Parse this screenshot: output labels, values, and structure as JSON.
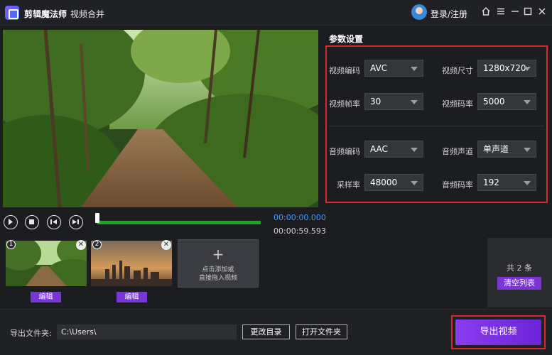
{
  "header": {
    "app_name": "剪辑魔法师",
    "separator": "-",
    "page_title": "视频合并",
    "login_label": "登录/注册",
    "icons": [
      "home-icon",
      "menu-icon",
      "minimize-icon",
      "maximize-icon",
      "close-icon"
    ]
  },
  "params": {
    "title": "参数设置",
    "video_codec": {
      "label": "视频编码",
      "value": "AVC"
    },
    "video_size": {
      "label": "视频尺寸",
      "value": "1280x720"
    },
    "video_fps": {
      "label": "视频帧率",
      "value": "30"
    },
    "video_bitrate": {
      "label": "视频码率",
      "value": "5000"
    },
    "audio_codec": {
      "label": "音频编码",
      "value": "AAC"
    },
    "audio_channel": {
      "label": "音频声道",
      "value": "单声道"
    },
    "sample_rate": {
      "label": "采样率",
      "value": "48000"
    },
    "audio_bitrate": {
      "label": "音频码率",
      "value": "192"
    }
  },
  "player": {
    "current_time": "00:00:00.000",
    "total_time": "00:00:59.593",
    "progress": 0
  },
  "clips": [
    {
      "number": "1",
      "edit_label": "编辑"
    },
    {
      "number": "2",
      "edit_label": "编辑"
    }
  ],
  "add_clip": {
    "plus": "+",
    "line1": "点击添加或",
    "line2": "直接拖入视频"
  },
  "list": {
    "count_label": "共 2 条",
    "clear_label": "清空列表"
  },
  "footer": {
    "output_label": "导出文件夹:",
    "output_path": "C:\\Users\\",
    "change_dir_label": "更改目录",
    "open_folder_label": "打开文件夹",
    "export_label": "导出视频"
  },
  "colors": {
    "accent_purple": "#7a35d8",
    "highlight_red": "#d62b2b",
    "progress_green": "#19a81c",
    "time_blue": "#3c9bff"
  }
}
